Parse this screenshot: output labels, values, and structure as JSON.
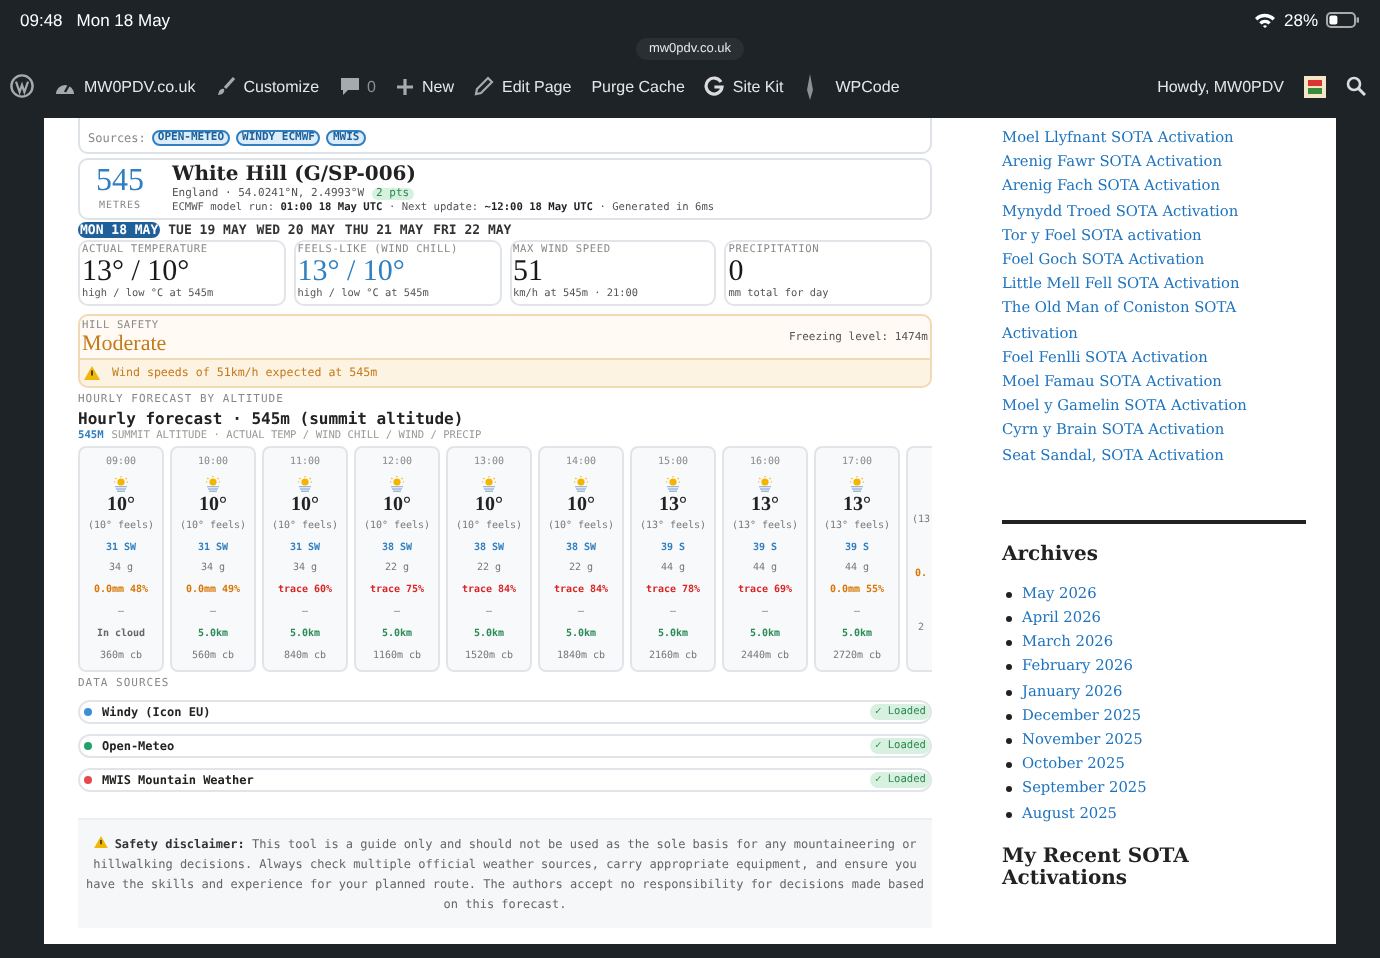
{
  "status_bar": {
    "time": "09:48",
    "date": "Mon 18 May",
    "battery": "28%"
  },
  "url": "mw0pdv.co.uk",
  "admin_bar": {
    "items": [
      {
        "kind": "wp"
      },
      {
        "kind": "site",
        "label": "MW0PDV.co.uk"
      },
      {
        "kind": "brush",
        "label": "Customize"
      },
      {
        "kind": "comment",
        "label": "0"
      },
      {
        "kind": "plus",
        "label": "New"
      },
      {
        "kind": "pencil",
        "label": "Edit Page"
      },
      {
        "kind": "text",
        "label": "Purge Cache"
      },
      {
        "kind": "g",
        "label": "Site Kit"
      },
      {
        "kind": "pen"
      },
      {
        "kind": "text",
        "label": "WPCode"
      }
    ],
    "greeting": "Howdy, MW0PDV"
  },
  "sources": {
    "label": "Sources:",
    "badges": [
      "OPEN-METEO",
      "WINDY ECMWF",
      "MWIS"
    ]
  },
  "location": {
    "altitude": "545",
    "unit": "METRES",
    "title": "White Hill (G/SP-006)",
    "region": "England · 54.0241°N, 2.4993°W",
    "points": "2 pts",
    "model_line": "ECMWF model run: **01:00 18 May UTC** · Next update: **~12:00 18 May UTC** · Generated in 6ms"
  },
  "day_tabs": [
    {
      "label": "MON 18 MAY",
      "selected": true
    },
    {
      "label": "TUE 19 MAY",
      "selected": false
    },
    {
      "label": "WED 20 MAY",
      "selected": false
    },
    {
      "label": "THU 21 MAY",
      "selected": false
    },
    {
      "label": "FRI 22 MAY",
      "selected": false
    }
  ],
  "stats": [
    {
      "label": "ACTUAL TEMPERATURE",
      "value": "13° / 10°",
      "sub": "high / low °C at 545m",
      "color": "#1a1a1a"
    },
    {
      "label": "FEELS-LIKE (WIND CHILL)",
      "value": "13° / 10°",
      "sub": "high / low °C at 545m",
      "color": "#2f7fc1"
    },
    {
      "label": "MAX WIND SPEED",
      "value": "51",
      "sub": "km/h at 545m · 21:00",
      "color": "#1a1a1a"
    },
    {
      "label": "PRECIPITATION",
      "value": "0",
      "sub": "mm total for day",
      "color": "#1a1a1a"
    }
  ],
  "hill_safety": {
    "label": "HILL SAFETY",
    "level": "Moderate",
    "freezing": "Freezing level: 1474m",
    "warning": "Wind speeds of 51km/h expected at 545m"
  },
  "hourly": {
    "section": "HOURLY FORECAST BY ALTITUDE",
    "title": "Hourly forecast · 545m (summit altitude)",
    "altitude": "545M",
    "subtitle": "SUMMIT ALTITUDE · ACTUAL TEMP / WIND CHILL / WIND / PRECIP",
    "hours": [
      {
        "time": "09:00",
        "temp": "10°",
        "feels": "(10° feels)",
        "wind": "31 SW",
        "gust": "34 g",
        "precip": {
          "text": "0.0mm 48%",
          "color": "#d97706"
        },
        "sep": "–",
        "vis": {
          "text": "In cloud",
          "color": "#666666"
        },
        "cb": "360m cb"
      },
      {
        "time": "10:00",
        "temp": "10°",
        "feels": "(10° feels)",
        "wind": "31 SW",
        "gust": "34 g",
        "precip": {
          "text": "0.0mm 49%",
          "color": "#d97706"
        },
        "sep": "–",
        "vis": {
          "text": "5.0km",
          "color": "#2e8b57"
        },
        "cb": "560m cb"
      },
      {
        "time": "11:00",
        "temp": "10°",
        "feels": "(10° feels)",
        "wind": "31 SW",
        "gust": "34 g",
        "precip": {
          "text": "trace 60%",
          "color": "#dc2626"
        },
        "sep": "–",
        "vis": {
          "text": "5.0km",
          "color": "#2e8b57"
        },
        "cb": "840m cb"
      },
      {
        "time": "12:00",
        "temp": "10°",
        "feels": "(10° feels)",
        "wind": "38 SW",
        "gust": "22 g",
        "precip": {
          "text": "trace 75%",
          "color": "#dc2626"
        },
        "sep": "–",
        "vis": {
          "text": "5.0km",
          "color": "#2e8b57"
        },
        "cb": "1160m cb"
      },
      {
        "time": "13:00",
        "temp": "10°",
        "feels": "(10° feels)",
        "wind": "38 SW",
        "gust": "22 g",
        "precip": {
          "text": "trace 84%",
          "color": "#dc2626"
        },
        "sep": "–",
        "vis": {
          "text": "5.0km",
          "color": "#2e8b57"
        },
        "cb": "1520m cb"
      },
      {
        "time": "14:00",
        "temp": "10°",
        "feels": "(10° feels)",
        "wind": "38 SW",
        "gust": "22 g",
        "precip": {
          "text": "trace 84%",
          "color": "#dc2626"
        },
        "sep": "–",
        "vis": {
          "text": "5.0km",
          "color": "#2e8b57"
        },
        "cb": "1840m cb"
      },
      {
        "time": "15:00",
        "temp": "13°",
        "feels": "(13° feels)",
        "wind": "39 S",
        "gust": "44 g",
        "precip": {
          "text": "trace 78%",
          "color": "#dc2626"
        },
        "sep": "–",
        "vis": {
          "text": "5.0km",
          "color": "#2e8b57"
        },
        "cb": "2160m cb"
      },
      {
        "time": "16:00",
        "temp": "13°",
        "feels": "(13° feels)",
        "wind": "39 S",
        "gust": "44 g",
        "precip": {
          "text": "trace 69%",
          "color": "#dc2626"
        },
        "sep": "–",
        "vis": {
          "text": "5.0km",
          "color": "#2e8b57"
        },
        "cb": "2440m cb"
      },
      {
        "time": "17:00",
        "temp": "13°",
        "feels": "(13° feels)",
        "wind": "39 S",
        "gust": "44 g",
        "precip": {
          "text": "0.0mm 55%",
          "color": "#d97706"
        },
        "sep": "–",
        "vis": {
          "text": "5.0km",
          "color": "#2e8b57"
        },
        "cb": "2720m cb"
      }
    ],
    "partial": {
      "feels": "(13",
      "precip": "0.",
      "cb": "2"
    }
  },
  "data_sources": {
    "label": "DATA SOURCES",
    "items": [
      {
        "name": "Windy (Icon EU)",
        "color": "#3b8fd9",
        "status": "✓ Loaded"
      },
      {
        "name": "Open-Meteo",
        "color": "#22a06b",
        "status": "✓ Loaded"
      },
      {
        "name": "MWIS Mountain Weather",
        "color": "#e5484d",
        "status": "✓ Loaded"
      }
    ]
  },
  "disclaimer": {
    "title": "Safety disclaimer:",
    "text": "This tool is a guide only and should not be used as the sole basis for any mountaineering or hillwalking decisions. Always check multiple official weather sources, carry appropriate equipment, and ensure you have the skills and experience for your planned route. The authors accept no responsibility for decisions made based on this forecast."
  },
  "sidebar": {
    "posts": [
      "Moel Llyfnant SOTA Activation",
      "Arenig Fawr SOTA Activation",
      "Arenig Fach SOTA Activation",
      "Mynydd Troed SOTA Activation",
      "Tor y Foel SOTA activation",
      "Foel Goch SOTA Activation",
      "Little Mell Fell SOTA Activation",
      "The Old Man of Coniston SOTA Activation",
      "Foel Fenlli SOTA Activation",
      "Moel Famau SOTA Activation",
      "Moel y Gamelin SOTA Activation",
      "Cyrn y Brain SOTA Activation",
      "Seat Sandal, SOTA Activation"
    ],
    "archives_title": "Archives",
    "archives": [
      "May 2026",
      "April 2026",
      "March 2026",
      "February 2026",
      "January 2026",
      "December 2025",
      "November 2025",
      "October 2025",
      "September 2025",
      "August 2025"
    ],
    "recent_title": "My Recent SOTA Activations"
  }
}
